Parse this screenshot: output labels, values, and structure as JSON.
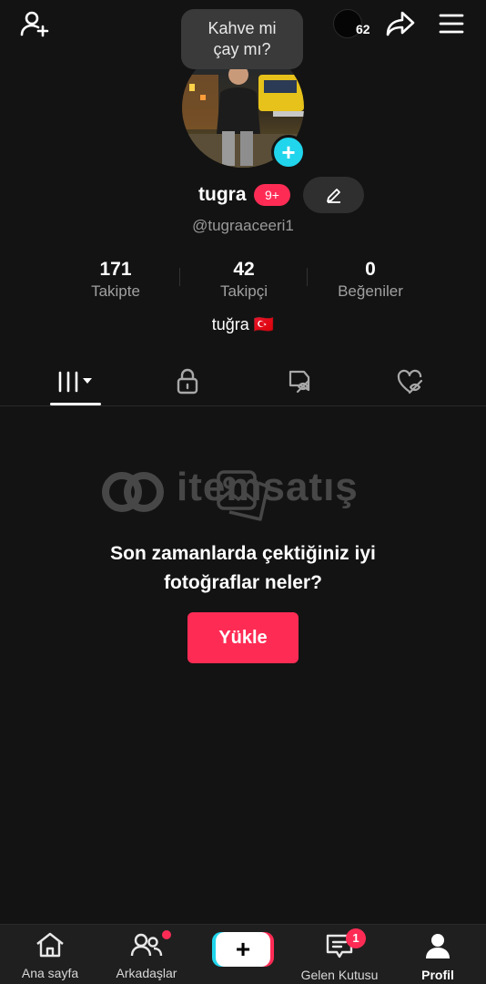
{
  "top": {
    "coins": "62",
    "bubble_text": "Kahve mi\nçay mı?"
  },
  "profile": {
    "username": "tugra",
    "notification_pill": "9+",
    "handle": "@tugraaceeri1",
    "bio": "tuğra 🇹🇷"
  },
  "stats": [
    {
      "value": "171",
      "label": "Takipte"
    },
    {
      "value": "42",
      "label": "Takipçi"
    },
    {
      "value": "0",
      "label": "Beğeniler"
    }
  ],
  "tabs": [
    {
      "icon": "grid-icon",
      "active": true
    },
    {
      "icon": "lock-icon",
      "active": false
    },
    {
      "icon": "hidden-tag-icon",
      "active": false
    },
    {
      "icon": "liked-heart-icon",
      "active": false
    }
  ],
  "empty_state": {
    "title": "Son zamanlarda çektiğiniz iyi\nfotoğraflar neler?",
    "button": "Yükle",
    "watermark": "itemsatış"
  },
  "bottom_nav": [
    {
      "label": "Ana sayfa",
      "icon": "home-icon"
    },
    {
      "label": "Arkadaşlar",
      "icon": "friends-icon"
    },
    {
      "label": "",
      "icon": "plus-icon"
    },
    {
      "label": "Gelen Kutusu",
      "icon": "inbox-icon",
      "badge": "1"
    },
    {
      "label": "Profil",
      "icon": "profile-icon",
      "active": true
    }
  ],
  "colors": {
    "accent": "#fe2c55",
    "cyan": "#20d5ec",
    "background": "#131313"
  }
}
